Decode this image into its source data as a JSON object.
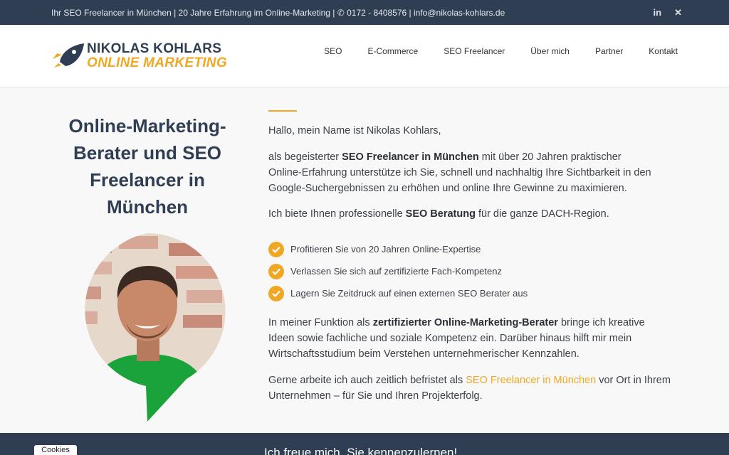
{
  "topbar": {
    "info": "Ihr SEO Freelancer in München | 20 Jahre Erfahrung im Online-Marketing | ✆ 0172 - 8408576  |  info@nikolas-kohlars.de",
    "social": [
      "in",
      "✕"
    ]
  },
  "logo": {
    "line1": "NIKOLAS KOHLARS",
    "line2": "ONLINE MARKETING"
  },
  "nav": [
    "SEO",
    "E-Commerce",
    "SEO Freelancer",
    "Über mich",
    "Partner",
    "Kontakt"
  ],
  "hero": {
    "title": "Online-Marketing-Berater und SEO Freelancer in München"
  },
  "intro": {
    "greeting": "Hallo, mein Name ist Nikolas Kohlars,",
    "p1_pre": "als begeisterter ",
    "p1_bold": "SEO Freelancer in München",
    "p1_post": " mit über 20 Jahren praktischer Online-Erfahrung unterstütze ich Sie, schnell und nachhaltig Ihre Sichtbarkeit in den Google-Suchergebnissen zu erhöhen und online Ihre Gewinne zu maximieren.",
    "p2_pre": "Ich biete Ihnen professionelle ",
    "p2_bold": "SEO Beratung",
    "p2_post": " für die ganze DACH-Region."
  },
  "checks": [
    "Profitieren Sie von 20 Jahren Online-Expertise",
    "Verlassen Sie sich auf zertifizierte Fach-Kompetenz",
    "Lagern Sie Zeitdruck auf einen externen SEO Berater aus"
  ],
  "more": {
    "p3_pre": "In meiner Funktion als ",
    "p3_bold": "zertifizierter Online-Marketing-Berater",
    "p3_post": " bringe ich kreative Ideen sowie fachliche und soziale Kompetenz ein. Darüber hinaus hilft mir mein Wirtschaftsstudium beim Verstehen unternehmerischer Kennzahlen.",
    "p4_pre": "Gerne arbeite ich auch zeitlich befristet als ",
    "p4_link": "SEO Freelancer in München",
    "p4_post": " vor Ort in Ihrem Unternehmen – für Sie und Ihren Projekterfolg."
  },
  "footer": {
    "teaser": "Ich freue mich, Sie kennenzulernen!"
  },
  "cookies": "Cookies",
  "colors": {
    "navy": "#2f3e52",
    "accent": "#f0a824",
    "green": "#1aa33a"
  }
}
